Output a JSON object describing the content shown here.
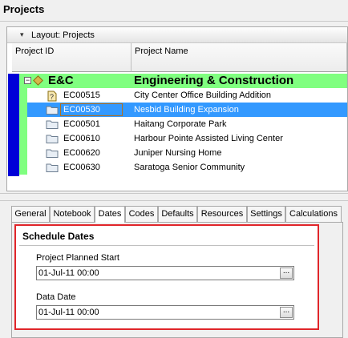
{
  "window": {
    "title": "Projects"
  },
  "layout": {
    "label": "Layout: Projects"
  },
  "columns": {
    "project_id": "Project ID",
    "project_name": "Project Name"
  },
  "group": {
    "id": "E&C",
    "name": "Engineering & Construction"
  },
  "projects": [
    {
      "id": "EC00515",
      "name": "City Center Office Building Addition",
      "icon": "project-lock-icon",
      "selected": false
    },
    {
      "id": "EC00530",
      "name": "Nesbid Building Expansion",
      "icon": "folder-icon",
      "selected": true
    },
    {
      "id": "EC00501",
      "name": "Haitang Corporate Park",
      "icon": "folder-icon",
      "selected": false
    },
    {
      "id": "EC00610",
      "name": "Harbour Pointe Assisted Living Center",
      "icon": "folder-icon",
      "selected": false
    },
    {
      "id": "EC00620",
      "name": "Juniper Nursing Home",
      "icon": "folder-icon",
      "selected": false
    },
    {
      "id": "EC00630",
      "name": "Saratoga Senior Community",
      "icon": "folder-icon",
      "selected": false
    }
  ],
  "tabs": [
    {
      "label": "General",
      "active": false
    },
    {
      "label": "Notebook",
      "active": false
    },
    {
      "label": "Dates",
      "active": true
    },
    {
      "label": "Codes",
      "active": false
    },
    {
      "label": "Defaults",
      "active": false
    },
    {
      "label": "Resources",
      "active": false
    },
    {
      "label": "Settings",
      "active": false
    },
    {
      "label": "Calculations",
      "active": false
    }
  ],
  "schedule": {
    "title": "Schedule Dates",
    "planned_start": {
      "label": "Project Planned Start",
      "value": "01-Jul-11 00:00",
      "button": "..."
    },
    "data_date": {
      "label": "Data Date",
      "value": "01-Jul-11 00:00",
      "button": "..."
    }
  },
  "colors": {
    "selection": "#3399ff",
    "group_band": "#80ff80",
    "wbs_bar": "#0000d8",
    "highlight": "#e0252a"
  }
}
